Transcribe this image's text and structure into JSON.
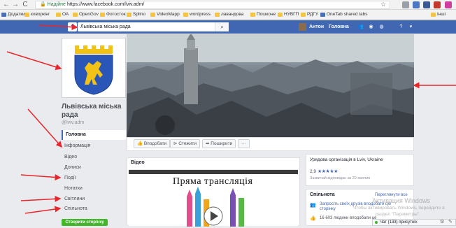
{
  "browser": {
    "nav": [
      "←",
      "→",
      "C"
    ],
    "secure_label": "Надійне",
    "url": "https://www.facebook.com/lviv.adm/",
    "bookmarks": [
      {
        "label": "Додатки",
        "page": true
      },
      {
        "label": "коворкінг"
      },
      {
        "label": "ОА"
      },
      {
        "label": "OpenGov"
      },
      {
        "label": "Фотосток"
      },
      {
        "label": "Splino"
      },
      {
        "label": "VideoMapp"
      },
      {
        "label": "wordpress"
      },
      {
        "label": "лавандова"
      },
      {
        "label": "Пошконе"
      },
      {
        "label": "НУВГП"
      },
      {
        "label": "РДГУ"
      },
      {
        "label": "OneTab shared tabs",
        "page": true
      },
      {
        "label": "Інші"
      }
    ]
  },
  "facebook": {
    "logo": "f",
    "search_value": "Львівська міська рада",
    "search_icon": "search-icon",
    "user_name": "Антон",
    "home_label": "Головна",
    "brand_color": "#4267b2"
  },
  "page": {
    "name": "Львівська міська рада",
    "handle": "@lviv.adm",
    "nav": [
      {
        "label": "Головна",
        "active": true
      },
      {
        "label": "Інформація"
      },
      {
        "label": "Відео"
      },
      {
        "label": "Дописи"
      },
      {
        "label": "Події"
      },
      {
        "label": "Нотатки"
      },
      {
        "label": "Світлини"
      },
      {
        "label": "Спільнота"
      }
    ],
    "create_button": "Створити сторінку",
    "actions": {
      "like": "Вподобати",
      "follow": "Стежити",
      "share": "Поширити",
      "more": "···"
    }
  },
  "video": {
    "title": "Відео",
    "overlay": "Пряма трансляція"
  },
  "about": {
    "type": "Урядова організація в Lviv, Ukraine",
    "rating": "2,9",
    "stars": "★★★★★",
    "respond": "Зазвичай відповідає за 20 хвилин"
  },
  "community": {
    "title": "Спільнота",
    "see_all": "Переглянути все",
    "invite": "Запросіть своїх друзів вподобати цю сторінку",
    "likes": "16 603 людини вподобали це"
  },
  "watermark": {
    "line1": "Активация Windows",
    "line2": "Чтобы активировать Windows, перейдите в",
    "line3": "раздел \"Параметры\"."
  },
  "chat": {
    "label": "Чат (133) присутніх"
  },
  "colors": {
    "annotation_arrow": "#e8262b",
    "create_button": "#42b72a"
  }
}
